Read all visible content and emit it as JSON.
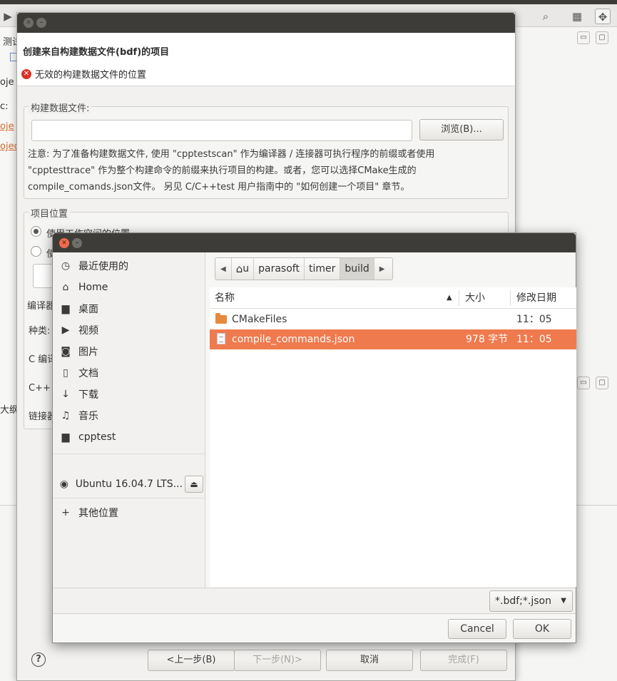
{
  "ide": {
    "left_fragments": [
      "测试",
      "oje",
      "c:",
      "oje",
      "ojec"
    ],
    "outline_fragment": "大纲"
  },
  "wizard": {
    "title": "创建来自构建数据文件(bdf)的项目",
    "error": "无效的构建数据文件的位置",
    "bdf_group": {
      "label": "构建数据文件:",
      "input_value": "",
      "browse_label": "浏览(B)...",
      "note": "注意: 为了准备构建数据文件, 使用 \"cpptestscan\" 作为编译器 / 连接器可执行程序的前缀或者使用 \"cpptesttrace\" 作为整个构建命令的前缀来执行项目的构建。或者，您可以选择CMake生成的 compile_comands.json文件。 另见 C/C++test 用户指南中的 \"如何创建一个项目\" 章节。"
    },
    "location_group": {
      "label": "项目位置",
      "option1": "使用工作空间的位置",
      "option2_fragment": "使"
    },
    "compiler_fragments": {
      "group": "编译器",
      "kind": "种类:",
      "c": "C 编译",
      "cpp": "C++ 编",
      "linker": "链接器"
    },
    "buttons": {
      "back": "<上一步(B)",
      "next": "下一步(N)>",
      "cancel": "取消",
      "finish": "完成(F)"
    }
  },
  "chooser": {
    "places": [
      {
        "icon": "clock-icon",
        "glyph": "◷",
        "label": "最近使用的"
      },
      {
        "icon": "home-icon",
        "glyph": "⌂",
        "label": "Home"
      },
      {
        "icon": "folder-icon",
        "glyph": "▆",
        "label": "桌面"
      },
      {
        "icon": "video-icon",
        "glyph": "▶",
        "label": "视频"
      },
      {
        "icon": "camera-icon",
        "glyph": "◙",
        "label": "图片"
      },
      {
        "icon": "document-icon",
        "glyph": "▯",
        "label": "文档"
      },
      {
        "icon": "download-icon",
        "glyph": "↓",
        "label": "下载"
      },
      {
        "icon": "music-icon",
        "glyph": "♫",
        "label": "音乐"
      },
      {
        "icon": "folder-icon",
        "glyph": "▆",
        "label": "cpptest"
      }
    ],
    "device": {
      "label": "Ubuntu 16.04.7 LTS...",
      "eject_icon": "eject-icon"
    },
    "other_locations": "其他位置",
    "path": {
      "home": "u",
      "segments": [
        "parasoft",
        "timer",
        "build"
      ]
    },
    "columns": {
      "name": "名称",
      "size": "大小",
      "modified": "修改日期"
    },
    "files": [
      {
        "name": "CMakeFiles",
        "type": "folder",
        "size": "",
        "modified": "11：05"
      },
      {
        "name": "compile_commands.json",
        "type": "file",
        "size": "978 字节",
        "modified": "11：05"
      }
    ],
    "filter": "*.bdf;*.json",
    "cancel": "Cancel",
    "ok": "OK"
  }
}
